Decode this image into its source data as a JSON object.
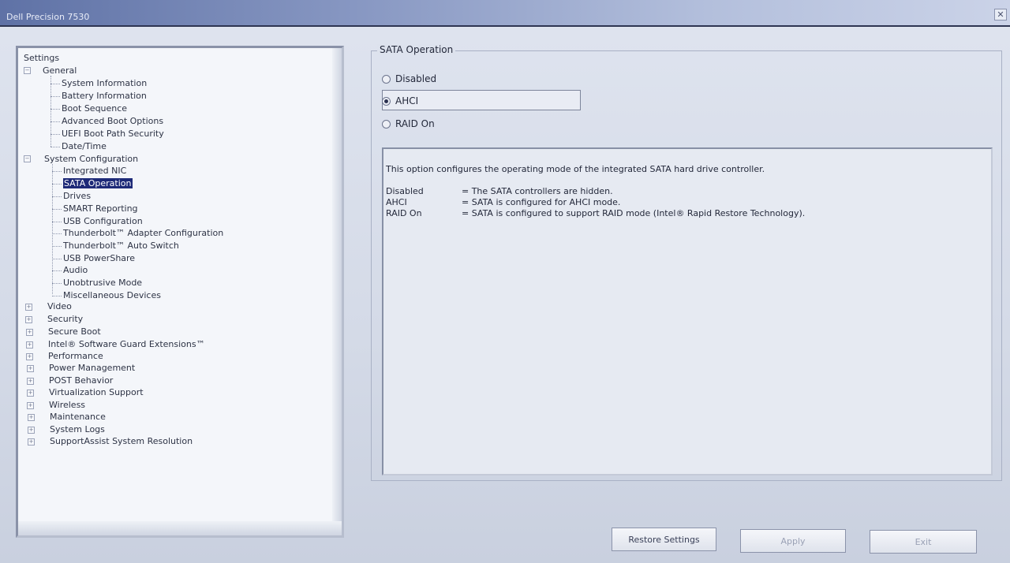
{
  "window": {
    "title": "Dell Precision 7530",
    "close_glyph": "✕"
  },
  "tree": {
    "root": "Settings",
    "general": {
      "label": "General",
      "children": [
        "System Information",
        "Battery Information",
        "Boot Sequence",
        "Advanced Boot Options",
        "UEFI Boot Path Security",
        "Date/Time"
      ]
    },
    "system_configuration": {
      "label": "System Configuration",
      "children": [
        "Integrated NIC",
        "SATA Operation",
        "Drives",
        "SMART Reporting",
        "USB Configuration",
        "Thunderbolt™ Adapter Configuration",
        "Thunderbolt™ Auto Switch",
        "USB PowerShare",
        "Audio",
        "Unobtrusive Mode",
        "Miscellaneous Devices"
      ]
    },
    "collapsed": [
      "Video",
      "Security",
      "Secure Boot",
      "Intel® Software Guard Extensions™",
      "Performance",
      "Power Management",
      "POST Behavior",
      "Virtualization Support",
      "Wireless",
      "Maintenance",
      "System Logs",
      "SupportAssist System Resolution"
    ],
    "selected": "SATA Operation"
  },
  "group": {
    "title": "SATA Operation",
    "options": [
      {
        "label": "Disabled",
        "checked": false
      },
      {
        "label": "AHCI",
        "checked": true
      },
      {
        "label": "RAID On",
        "checked": false
      }
    ]
  },
  "description": {
    "intro": "This option configures the operating mode of the integrated SATA hard drive controller.",
    "rows": [
      {
        "key": "Disabled",
        "value": "= The SATA controllers are hidden."
      },
      {
        "key": "AHCI",
        "value": "= SATA is configured for AHCI mode."
      },
      {
        "key": "RAID On",
        "value": "= SATA is configured to support RAID mode (Intel® Rapid Restore Technology)."
      }
    ]
  },
  "buttons": {
    "restore": "Restore Settings",
    "apply": "Apply",
    "exit": "Exit"
  }
}
